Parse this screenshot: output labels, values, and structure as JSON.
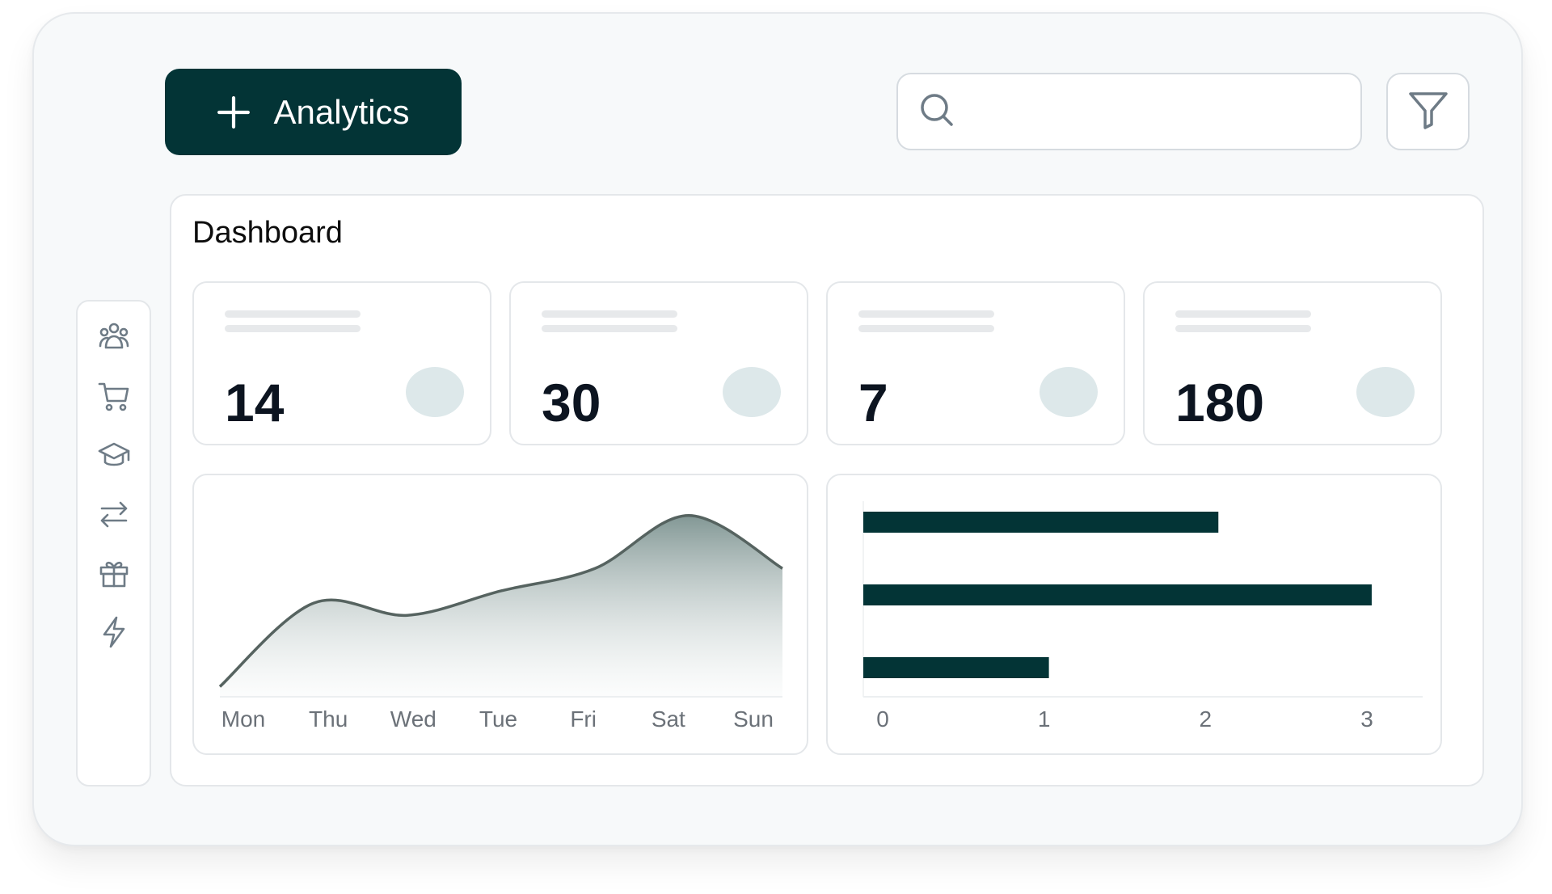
{
  "header": {
    "add_button_label": "Analytics",
    "search": {
      "value": "",
      "placeholder": ""
    }
  },
  "icons": {
    "add": "plus-icon",
    "search": "search-icon",
    "filter": "filter-icon"
  },
  "sidebar": {
    "items": [
      {
        "icon": "users-icon"
      },
      {
        "icon": "cart-icon"
      },
      {
        "icon": "graduation-cap-icon"
      },
      {
        "icon": "transfer-arrows-icon"
      },
      {
        "icon": "gift-icon"
      },
      {
        "icon": "lightning-icon"
      }
    ]
  },
  "dashboard": {
    "title": "Dashboard",
    "stats": [
      {
        "value": "14"
      },
      {
        "value": "30"
      },
      {
        "value": "7"
      },
      {
        "value": "180"
      }
    ]
  },
  "colors": {
    "primary": "#033436",
    "stat_dot": "#dde8ea",
    "area_line": "#566360"
  },
  "chart_data": [
    {
      "type": "area",
      "categories": [
        "Mon",
        "Thu",
        "Wed",
        "Tue",
        "Fri",
        "Sat",
        "Sun"
      ],
      "values": [
        5,
        46,
        40,
        52,
        63,
        89,
        63
      ],
      "ylim": [
        0,
        100
      ],
      "grid": false
    },
    {
      "type": "bar",
      "orientation": "horizontal",
      "categories": [
        "",
        "",
        ""
      ],
      "values": [
        2.2,
        3.15,
        1.15
      ],
      "xticks": [
        "0",
        "1",
        "2",
        "3"
      ],
      "xlim": [
        0,
        3.6
      ],
      "grid": false
    }
  ]
}
